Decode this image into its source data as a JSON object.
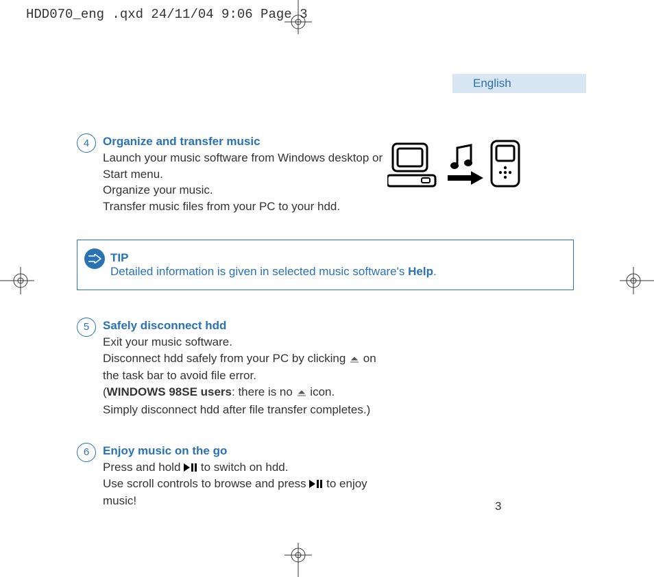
{
  "header": "HDD070_eng .qxd  24/11/04  9:06  Page 3",
  "language": "English",
  "step4": {
    "num": "4",
    "title": "Organize and transfer music",
    "line1": "Launch your music software from Windows desktop or Start menu.",
    "line2": "Organize your music.",
    "line3": "Transfer music files from your PC to your hdd."
  },
  "tip": {
    "label": "TIP",
    "text_a": "Detailed information is given in selected music software's ",
    "text_b": "Help",
    "text_c": "."
  },
  "step5": {
    "num": "5",
    "title": "Safely disconnect hdd",
    "line1": "Exit your music software.",
    "line2a": "Disconnect hdd safely from your PC by clicking ",
    "line2b": " on the task bar to avoid file error.",
    "line3a": "(",
    "line3b": "WINDOWS 98SE users",
    "line3c": ": there is  no ",
    "line3d": " icon.",
    "line4": "Simply disconnect hdd after file transfer completes.)"
  },
  "step6": {
    "num": "6",
    "title": "Enjoy music on the go",
    "line1a": "Press and hold ",
    "line1b": " to switch on hdd.",
    "line2a": "Use scroll controls to browse and press ",
    "line2b": " to enjoy music!"
  },
  "page_number": "3"
}
